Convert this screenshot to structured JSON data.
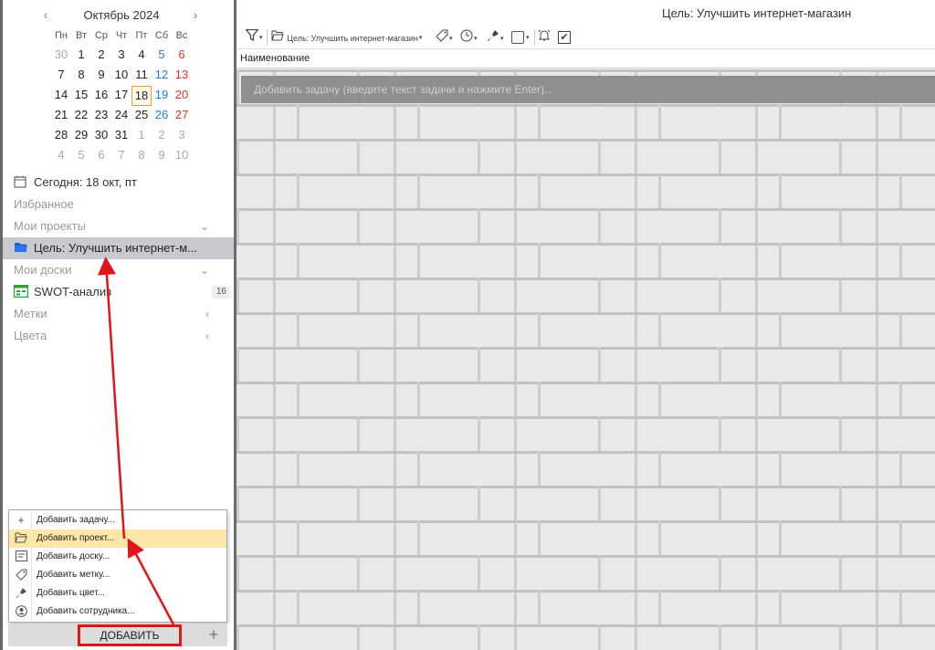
{
  "calendar": {
    "title": "Октябрь 2024",
    "prev_glyph": "‹",
    "next_glyph": "›",
    "weekdays": [
      "Пн",
      "Вт",
      "Ср",
      "Чт",
      "Пт",
      "Сб",
      "Вс"
    ],
    "weeks": [
      [
        "30",
        "1",
        "2",
        "3",
        "4",
        "5",
        "6"
      ],
      [
        "7",
        "8",
        "9",
        "10",
        "11",
        "12",
        "13"
      ],
      [
        "14",
        "15",
        "16",
        "17",
        "18",
        "19",
        "20"
      ],
      [
        "21",
        "22",
        "23",
        "24",
        "25",
        "26",
        "27"
      ],
      [
        "28",
        "29",
        "30",
        "31",
        "1",
        "2",
        "3"
      ],
      [
        "4",
        "5",
        "6",
        "7",
        "8",
        "9",
        "10"
      ]
    ],
    "today": "18"
  },
  "sidebar": {
    "today_label": "Сегодня: 18 окт, пт",
    "favorites": "Избранное",
    "my_projects": "Мои проекты",
    "selected_project": "Цель: Улучшить интернет-м...",
    "my_boards": "Мои доски",
    "board_name": "SWOT-анализ",
    "board_badge": "16",
    "tags": "Метки",
    "colors": "Цвета"
  },
  "add_menu": {
    "items": [
      {
        "label": "Добавить задачу...",
        "icon": "plus-icon"
      },
      {
        "label": "Добавить проект...",
        "icon": "folder-open-icon"
      },
      {
        "label": "Добавить доску...",
        "icon": "board-icon"
      },
      {
        "label": "Добавить метку...",
        "icon": "tag-icon"
      },
      {
        "label": "Добавить цвет...",
        "icon": "color-brush-icon"
      },
      {
        "label": "Добавить сотрудника...",
        "icon": "user-icon"
      }
    ]
  },
  "add_bar": {
    "button_label": "ДОБАВИТЬ",
    "plus_glyph": "+"
  },
  "main": {
    "window_title": "Цель: Улучшить интернет-магазин",
    "project_select": "Цель: Улучшить интернет-магазин",
    "column_name": "Наименование",
    "task_placeholder": "Добавить задачу (введите текст задачи и нажмите Enter)..."
  },
  "colors": {
    "annotation": "#e0151a",
    "selected_bg": "#c9c9cf",
    "menu_active": "#fde7a8",
    "saturday": "#1f7fd6",
    "sunday": "#e0332a"
  }
}
